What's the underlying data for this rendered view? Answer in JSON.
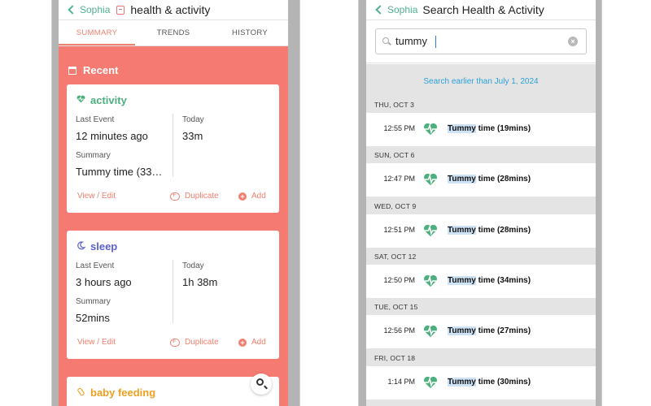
{
  "left": {
    "header": {
      "back_label": "Sophia",
      "title": "health & activity"
    },
    "tabs": [
      {
        "label": "SUMMARY",
        "active": true
      },
      {
        "label": "TRENDS",
        "active": false
      },
      {
        "label": "HISTORY",
        "active": false
      }
    ],
    "recent_label": "Recent",
    "cards": [
      {
        "title": "activity",
        "icon": "heartbeat-icon",
        "title_color": "#4caf7d",
        "last_event_label": "Last Event",
        "last_event_value": "12 minutes ago",
        "today_label": "Today",
        "today_value": "33m",
        "summary_label": "Summary",
        "summary_value": "Tummy time (33…",
        "view_edit": "View / Edit",
        "duplicate": "Duplicate",
        "add": "Add"
      },
      {
        "title": "sleep",
        "icon": "moon-icon",
        "title_color": "#5a5fcf",
        "last_event_label": "Last Event",
        "last_event_value": "3 hours ago",
        "today_label": "Today",
        "today_value": "1h 38m",
        "summary_label": "Summary",
        "summary_value": "52mins",
        "view_edit": "View / Edit",
        "duplicate": "Duplicate",
        "add": "Add"
      },
      {
        "title": "baby feeding",
        "icon": "bottle-icon",
        "title_color": "#f0a020"
      }
    ]
  },
  "right": {
    "header": {
      "back_label": "Sophia",
      "title": "Search Health & Activity"
    },
    "search": {
      "value": "tummy",
      "placeholder": ""
    },
    "earlier_link": "Search earlier than July 1, 2024",
    "days": [
      {
        "date": "THU, OCT 3",
        "time": "12:55 PM",
        "match": "Tummy",
        "rest": " time (19mins)"
      },
      {
        "date": "SUN, OCT 6",
        "time": "12:47 PM",
        "match": "Tummy",
        "rest": " time (28mins)"
      },
      {
        "date": "WED, OCT 9",
        "time": "12:51 PM",
        "match": "Tummy",
        "rest": " time (28mins)"
      },
      {
        "date": "SAT, OCT 12",
        "time": "12:50 PM",
        "match": "Tummy",
        "rest": " time (34mins)"
      },
      {
        "date": "TUE, OCT 15",
        "time": "12:56 PM",
        "match": "Tummy",
        "rest": " time (27mins)"
      },
      {
        "date": "FRI, OCT 18",
        "time": "1:14 PM",
        "match": "Tummy",
        "rest": " time (30mins)"
      }
    ]
  },
  "colors": {
    "accent": "#f47a72",
    "brand_green": "#4fb28e",
    "link_blue": "#2ba0d8",
    "heart_green": "#4caf7d"
  }
}
